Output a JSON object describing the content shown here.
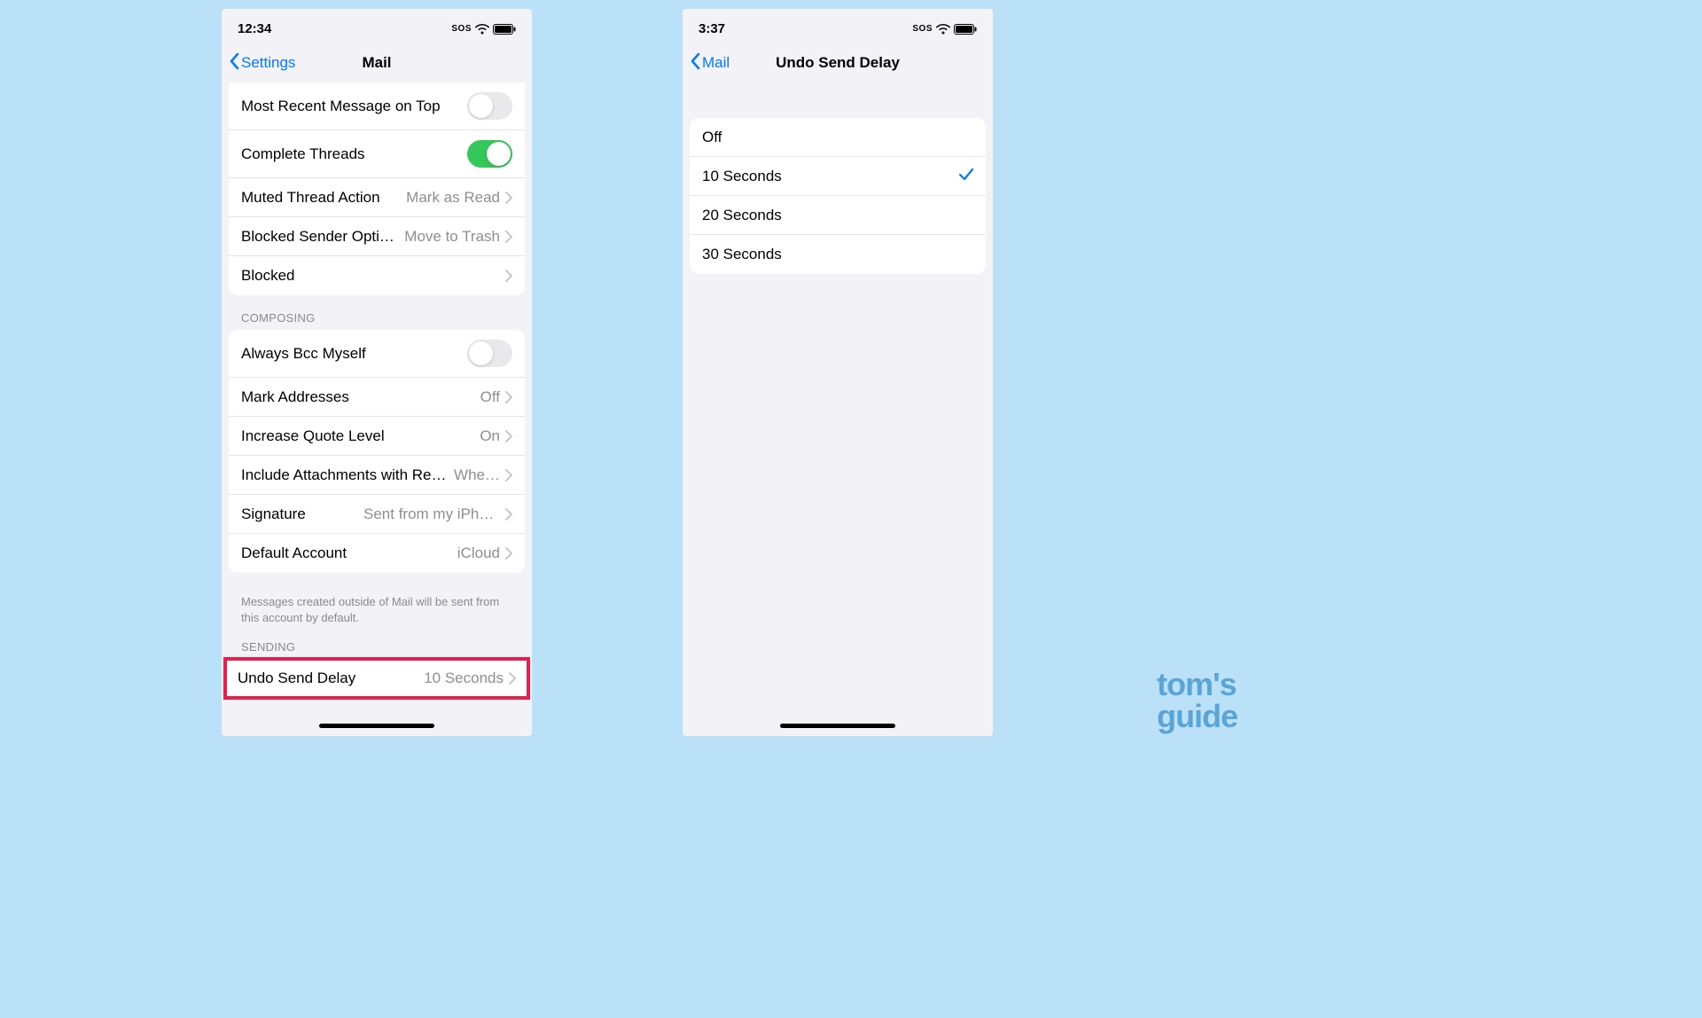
{
  "watermark": {
    "line1": "tom's",
    "line2": "guide"
  },
  "left": {
    "status": {
      "time": "12:34",
      "sos": "SOS"
    },
    "nav": {
      "back": "Settings",
      "title": "Mail"
    },
    "rows_g1": [
      {
        "label": "Most Recent Message on Top",
        "toggle": "off"
      },
      {
        "label": "Complete Threads",
        "toggle": "on"
      },
      {
        "label": "Muted Thread Action",
        "value": "Mark as Read",
        "chevron": true
      },
      {
        "label": "Blocked Sender Options",
        "value": "Move to Trash",
        "chevron": true
      },
      {
        "label": "Blocked",
        "chevron": true
      }
    ],
    "section2_header": "COMPOSING",
    "rows_g2": [
      {
        "label": "Always Bcc Myself",
        "toggle": "off"
      },
      {
        "label": "Mark Addresses",
        "value": "Off",
        "chevron": true
      },
      {
        "label": "Increase Quote Level",
        "value": "On",
        "chevron": true
      },
      {
        "label": "Include Attachments with Replies",
        "value": "Whe…",
        "chevron": true
      },
      {
        "label": "Signature",
        "value": "Sent from my iPhone",
        "chevron": true
      },
      {
        "label": "Default Account",
        "value": "iCloud",
        "chevron": true
      }
    ],
    "section2_footer": "Messages created outside of Mail will be sent from this account by default.",
    "section3_header": "SENDING",
    "rows_g3": [
      {
        "label": "Undo Send Delay",
        "value": "10 Seconds",
        "chevron": true
      }
    ]
  },
  "right": {
    "status": {
      "time": "3:37",
      "sos": "SOS"
    },
    "nav": {
      "back": "Mail",
      "title": "Undo Send Delay"
    },
    "options": [
      {
        "label": "Off",
        "selected": false
      },
      {
        "label": "10 Seconds",
        "selected": true
      },
      {
        "label": "20 Seconds",
        "selected": false
      },
      {
        "label": "30 Seconds",
        "selected": false
      }
    ]
  }
}
